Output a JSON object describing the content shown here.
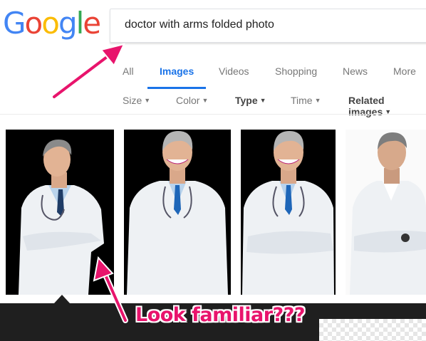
{
  "logo": {
    "letters": [
      "G",
      "o",
      "o",
      "g",
      "l",
      "e"
    ],
    "colors": [
      "#4285f4",
      "#ea4335",
      "#fbbc05",
      "#4285f4",
      "#34a853",
      "#ea4335"
    ]
  },
  "search": {
    "query": "doctor with arms folded photo"
  },
  "tabs": [
    {
      "label": "All",
      "active": false
    },
    {
      "label": "Images",
      "active": true
    },
    {
      "label": "Videos",
      "active": false
    },
    {
      "label": "Shopping",
      "active": false
    },
    {
      "label": "News",
      "active": false
    },
    {
      "label": "More",
      "active": false
    }
  ],
  "tools": [
    {
      "label": "Size",
      "caret": "▼"
    },
    {
      "label": "Color",
      "caret": "▼"
    },
    {
      "label": "Type",
      "caret": "▼"
    },
    {
      "label": "Time",
      "caret": "▼"
    },
    {
      "label": "Related images",
      "caret": "▼"
    }
  ],
  "results": [
    {
      "alt": "doctor with arms folded, black background"
    },
    {
      "alt": "smiling doctor, hands in pockets"
    },
    {
      "alt": "smiling doctor with arms folded"
    },
    {
      "alt": "serious doctor with arms folded"
    }
  ],
  "annotation": {
    "text": "Look familiar???",
    "color": "#e8146c"
  },
  "accent": "#1a73e8"
}
